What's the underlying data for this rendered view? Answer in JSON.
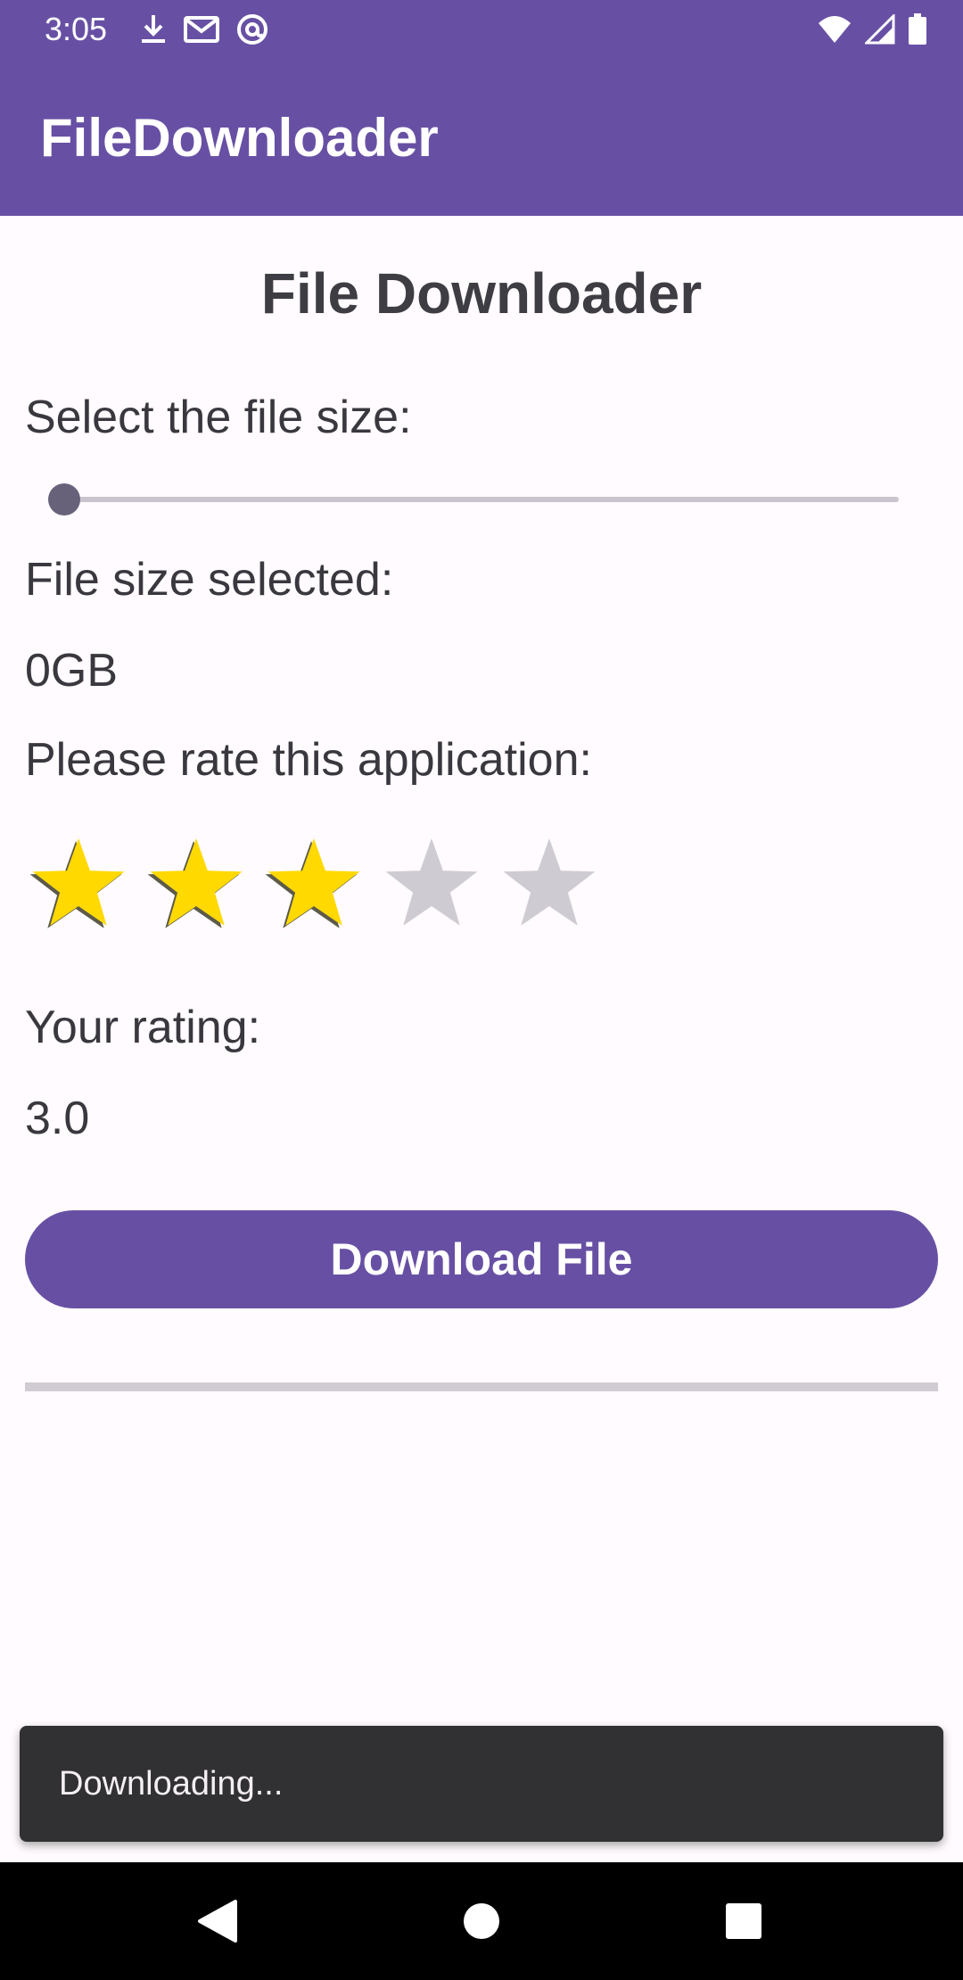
{
  "status_bar": {
    "time": "3:05",
    "left_icons": [
      "download-icon",
      "gmail-icon",
      "at-sign-icon"
    ],
    "right_icons": [
      "wifi-icon",
      "signal-icon",
      "battery-icon"
    ]
  },
  "app_bar": {
    "title": "FileDownloader"
  },
  "main": {
    "heading": "File Downloader",
    "select_size_label": "Select the file size:",
    "slider": {
      "value": 0,
      "min": 0,
      "max": 10
    },
    "size_selected_label": "File size selected:",
    "size_value": "0GB",
    "rate_label": "Please rate this application:",
    "rating": {
      "value": 3,
      "max": 5
    },
    "your_rating_label": "Your rating:",
    "rating_value": "3.0",
    "download_button": "Download File",
    "progress": 0
  },
  "snackbar": {
    "message": "Downloading..."
  },
  "nav_bar": {
    "buttons": [
      "back-icon",
      "home-icon",
      "recents-icon"
    ]
  },
  "colors": {
    "primary": "#6750a4",
    "star_filled": "#ffd900",
    "star_empty": "#cfcbd2",
    "snackbar_bg": "#313033"
  }
}
